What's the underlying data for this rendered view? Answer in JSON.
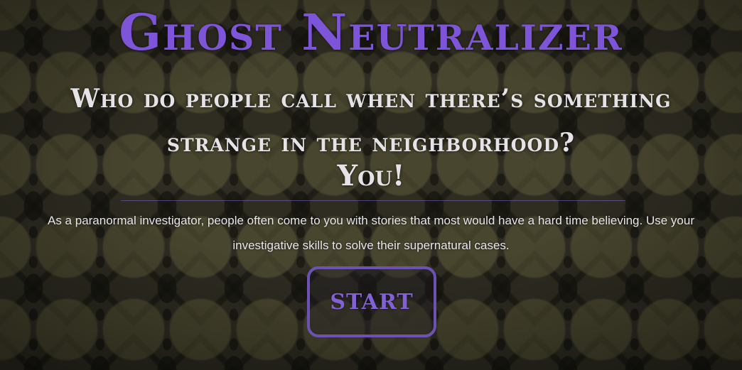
{
  "page": {
    "title": "Ghost Neutralizer",
    "tagline": "Who do people call when there’s something strange in the neighborhood?",
    "tagline_answer": "You!",
    "description": "As a paranormal investigator, people often come to you with stories that most would have a hard time believing. Use your investigative skills to solve their supernatural cases.",
    "start_button_label": "START"
  },
  "colors": {
    "accent": "#7e55d8",
    "button_border": "#6d52b3",
    "text": "#e6e3e8",
    "background": "#2f2d22"
  }
}
